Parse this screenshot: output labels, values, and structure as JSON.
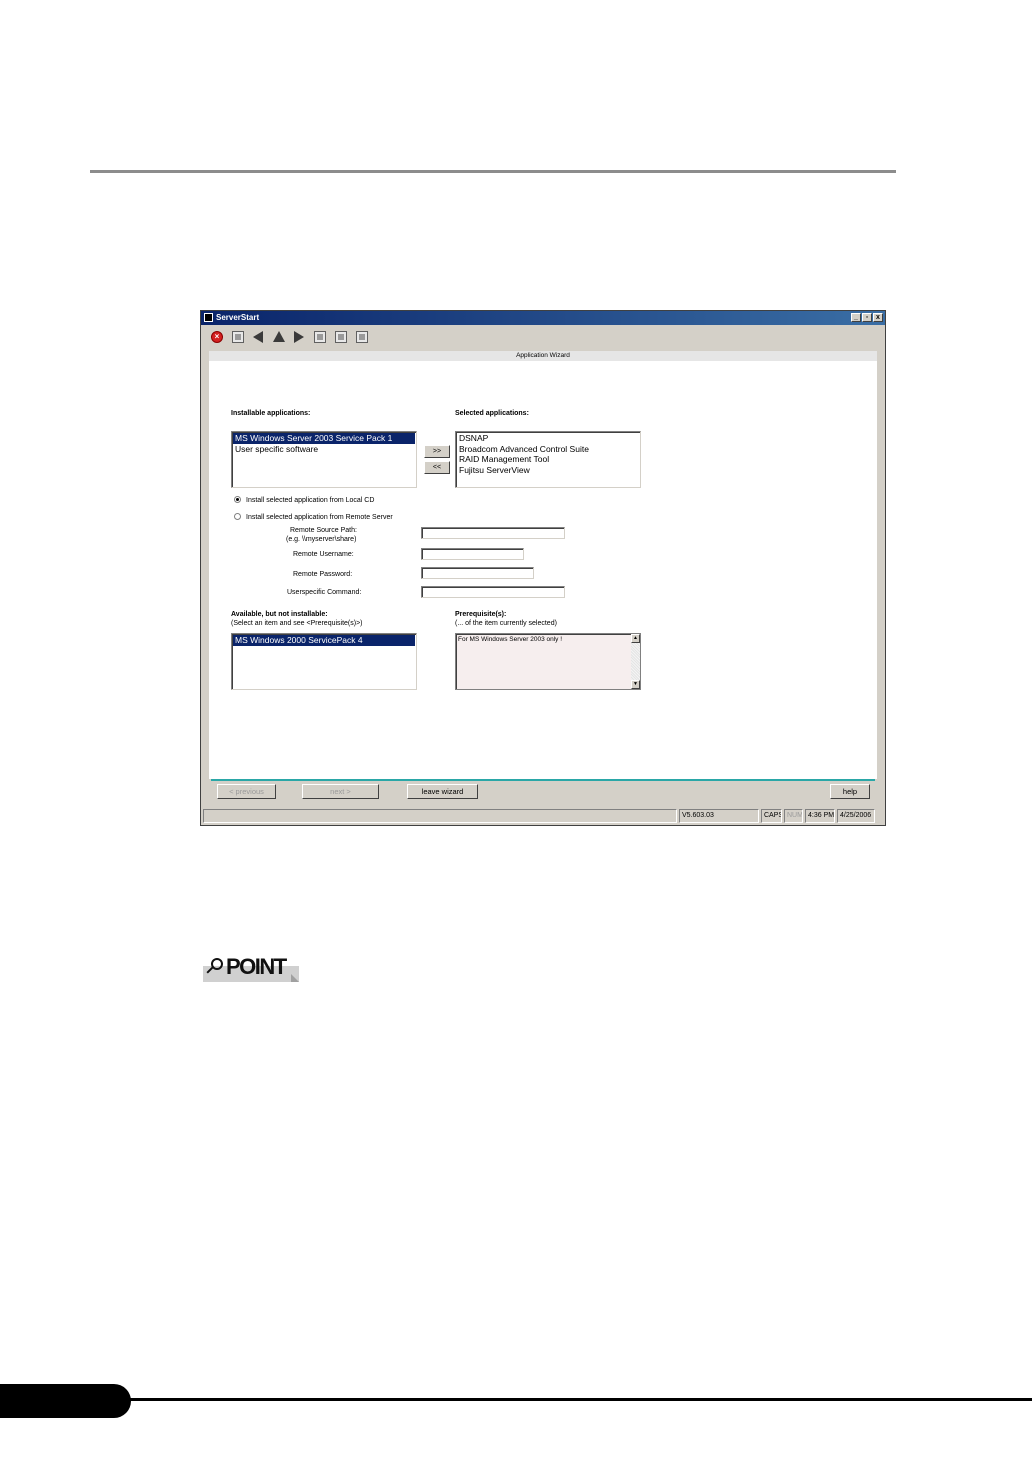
{
  "window": {
    "title": "ServerStart",
    "controls": {
      "minimize": "_",
      "restore": "▫",
      "close": "x"
    }
  },
  "toolbar": {
    "icons": [
      "stop-icon",
      "home-icon",
      "back-icon",
      "up-icon",
      "forward-icon",
      "save-icon",
      "window-icon",
      "grid-icon"
    ]
  },
  "wizard": {
    "header": "Application Wizard",
    "installable_label": "Installable applications:",
    "installable_items": [
      "MS Windows Server 2003 Service Pack 1",
      "User specific software"
    ],
    "selected_label": "Selected applications:",
    "selected_items": [
      "DSNAP",
      "Broadcom Advanced Control Suite",
      "RAID Management Tool",
      "Fujitsu ServerView"
    ],
    "add_button": ">>",
    "remove_button": "<<",
    "radio_local": "Install selected application from Local CD",
    "radio_remote": "Install selected application from Remote Server",
    "remote_source_label": "Remote Source Path:",
    "remote_source_hint": "(e.g. \\\\myserver\\share)",
    "remote_username_label": "Remote Username:",
    "remote_password_label": "Remote Password:",
    "userspecific_label": "Userspecific Command:",
    "available_label": "Available, but not installable:",
    "available_hint": "(Select an item and see <Prerequisite(s)>)",
    "available_items": [
      "MS Windows 2000 ServicePack 4"
    ],
    "prereq_label": "Prerequisite(s):",
    "prereq_hint": "(... of the item currently selected)",
    "prereq_text": "For MS Windows Server 2003 only !"
  },
  "buttons": {
    "previous": "< previous",
    "next": "next >",
    "leave": "leave wizard",
    "help": "help"
  },
  "status": {
    "version": "V5.603.03",
    "caps": "CAPS",
    "num": "NUM",
    "time": "4:36 PM",
    "date": "4/25/2006"
  },
  "point_label": "POINT"
}
